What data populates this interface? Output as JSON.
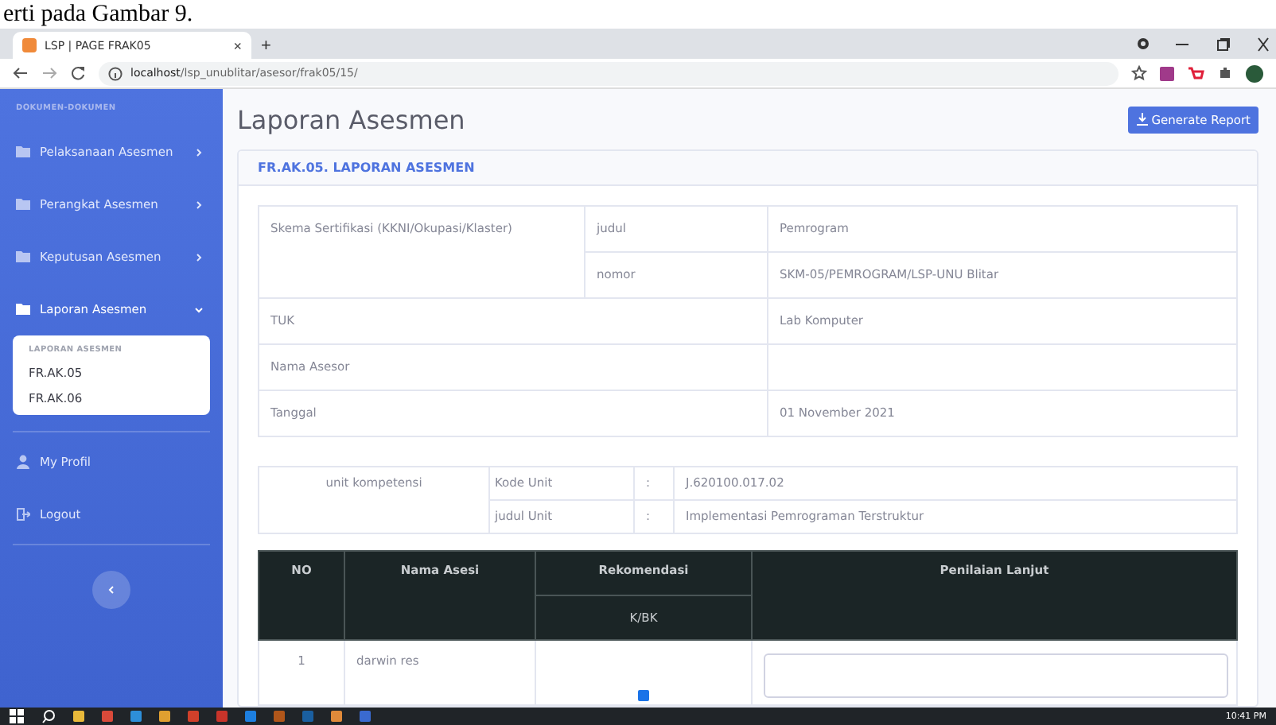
{
  "document_caption": "erti pada Gambar 9.",
  "browser": {
    "tab_title": "LSP | PAGE FRAK05",
    "tab_close": "×",
    "new_tab": "+",
    "url_host": "localhost",
    "url_path": "/lsp_unublitar/asesor/frak05/15/"
  },
  "sidebar": {
    "heading": "DOKUMEN-DOKUMEN",
    "items": [
      {
        "label": "Pelaksanaan Asesmen",
        "expanded": false
      },
      {
        "label": "Perangkat Asesmen",
        "expanded": false
      },
      {
        "label": "Keputusan Asesmen",
        "expanded": false
      },
      {
        "label": "Laporan Asesmen",
        "expanded": true,
        "submenu_heading": "LAPORAN ASESMEN",
        "children": [
          {
            "label": "FR.AK.05"
          },
          {
            "label": "FR.AK.06"
          }
        ]
      }
    ],
    "bottom_items": [
      {
        "label": "My Profil",
        "kind": "profile"
      },
      {
        "label": "Logout",
        "kind": "logout"
      }
    ]
  },
  "page_title": "Laporan Asesmen",
  "generate_button": "Generate Report",
  "card_title": "FR.AK.05. LAPORAN ASESMEN",
  "info_table": {
    "scheme_label": "Skema Sertifikasi (KKNI/Okupasi/Klaster)",
    "scheme_rows": [
      {
        "label": "judul",
        "value": "Pemrogram"
      },
      {
        "label": "nomor",
        "value": "SKM-05/PEMROGRAM/LSP-UNU Blitar"
      }
    ],
    "rows": [
      {
        "label": "TUK",
        "value": "Lab Komputer"
      },
      {
        "label": "Nama Asesor"
      },
      {
        "label": "Tanggal",
        "value": "01 November 2021"
      }
    ]
  },
  "unit_table": {
    "label": "unit kompetensi",
    "rows": [
      {
        "label": "Kode Unit",
        "sep": ":",
        "value": "J.620100.017.02"
      },
      {
        "label": "judul Unit",
        "sep": ":",
        "value": "Implementasi Pemrograman Terstruktur"
      }
    ]
  },
  "asesi_table": {
    "columns": [
      "NO",
      "Nama Asesi",
      "Rekomendasi",
      "Penilaian Lanjut"
    ],
    "sub_column": "K/BK",
    "rows": [
      {
        "no": "1",
        "name": "darwin res",
        "checked": true
      }
    ]
  },
  "taskbar": {
    "time": "10:41 PM"
  }
}
